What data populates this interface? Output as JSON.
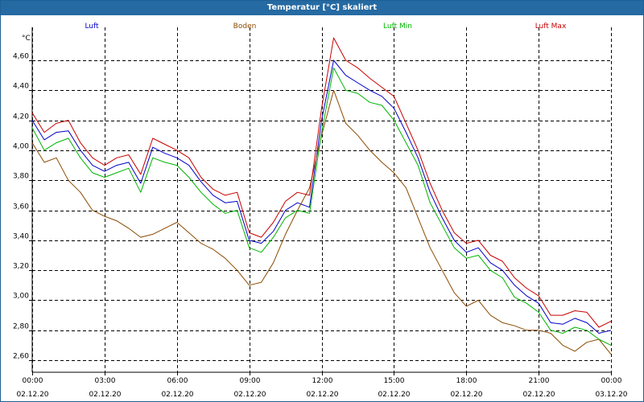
{
  "window": {
    "title": "Temperatur [°C] skaliert"
  },
  "colors": {
    "titlebar": "#256aa2",
    "grid": "#000000"
  },
  "chart_data": {
    "type": "line",
    "title": "Temperatur [°C] skaliert",
    "ylabel": "°C",
    "xlabel": "",
    "ylim": [
      2.52,
      4.82
    ],
    "grid": true,
    "legend": "top",
    "yticks": [
      2.6,
      2.8,
      3.0,
      3.2,
      3.4,
      3.6,
      3.8,
      4.0,
      4.2,
      4.4,
      4.6
    ],
    "ytick_labels": [
      "2,60",
      "2,80",
      "3,00",
      "3,20",
      "3,40",
      "3,60",
      "3,80",
      "4,00",
      "4,20",
      "4,40",
      "4,60"
    ],
    "x_hours_range": [
      0,
      24
    ],
    "xticks": [
      {
        "time": "00:00",
        "date": "02.12.20"
      },
      {
        "time": "03:00",
        "date": "02.12.20"
      },
      {
        "time": "06:00",
        "date": "02.12.20"
      },
      {
        "time": "09:00",
        "date": "02.12.20"
      },
      {
        "time": "12:00",
        "date": "02.12.20"
      },
      {
        "time": "15:00",
        "date": "02.12.20"
      },
      {
        "time": "18:00",
        "date": "02.12.20"
      },
      {
        "time": "21:00",
        "date": "02.12.20"
      },
      {
        "time": "00:00",
        "date": "03.12.20"
      }
    ],
    "x": [
      0,
      0.5,
      1,
      1.5,
      2,
      2.5,
      3,
      3.5,
      4,
      4.5,
      5,
      5.5,
      6,
      6.5,
      7,
      7.5,
      8,
      8.5,
      9,
      9.5,
      10,
      10.5,
      11,
      11.5,
      12,
      12.5,
      13,
      13.5,
      14,
      14.5,
      15,
      15.5,
      16,
      16.5,
      17,
      17.5,
      18,
      18.5,
      19,
      19.5,
      20,
      20.5,
      21,
      21.5,
      22,
      22.5,
      23,
      23.5,
      24
    ],
    "series": [
      {
        "name": "Luft",
        "color": "#0000c8",
        "values": [
          4.2,
          4.07,
          4.12,
          4.13,
          4.0,
          3.9,
          3.86,
          3.9,
          3.92,
          3.78,
          4.02,
          3.98,
          3.95,
          3.9,
          3.79,
          3.7,
          3.65,
          3.66,
          3.4,
          3.38,
          3.46,
          3.6,
          3.65,
          3.62,
          4.2,
          4.6,
          4.5,
          4.45,
          4.4,
          4.36,
          4.28,
          4.12,
          3.95,
          3.72,
          3.55,
          3.4,
          3.32,
          3.35,
          3.25,
          3.2,
          3.1,
          3.03,
          2.98,
          2.85,
          2.84,
          2.88,
          2.85,
          2.78,
          2.8
        ]
      },
      {
        "name": "Boden",
        "color": "#8b4a00",
        "values": [
          4.05,
          3.92,
          3.95,
          3.8,
          3.72,
          3.6,
          3.56,
          3.53,
          3.48,
          3.42,
          3.44,
          3.48,
          3.52,
          3.45,
          3.38,
          3.34,
          3.28,
          3.2,
          3.1,
          3.12,
          3.25,
          3.44,
          3.6,
          3.75,
          4.1,
          4.4,
          4.18,
          4.1,
          4.0,
          3.92,
          3.85,
          3.75,
          3.55,
          3.35,
          3.2,
          3.05,
          2.96,
          3.0,
          2.9,
          2.85,
          2.83,
          2.8,
          2.8,
          2.78,
          2.7,
          2.66,
          2.72,
          2.74,
          2.64
        ]
      },
      {
        "name": "Luft Min",
        "color": "#00b400",
        "values": [
          4.15,
          4.0,
          4.05,
          4.08,
          3.95,
          3.85,
          3.82,
          3.85,
          3.88,
          3.72,
          3.95,
          3.92,
          3.9,
          3.82,
          3.72,
          3.64,
          3.58,
          3.6,
          3.35,
          3.32,
          3.42,
          3.55,
          3.6,
          3.58,
          4.12,
          4.55,
          4.4,
          4.38,
          4.32,
          4.3,
          4.2,
          4.05,
          3.9,
          3.65,
          3.5,
          3.35,
          3.28,
          3.3,
          3.2,
          3.15,
          3.02,
          2.98,
          2.92,
          2.8,
          2.78,
          2.82,
          2.8,
          2.74,
          2.7
        ]
      },
      {
        "name": "Luft Max",
        "color": "#c80000",
        "values": [
          4.25,
          4.12,
          4.18,
          4.2,
          4.05,
          3.95,
          3.9,
          3.95,
          3.97,
          3.84,
          4.08,
          4.04,
          4.0,
          3.95,
          3.82,
          3.74,
          3.7,
          3.72,
          3.45,
          3.42,
          3.52,
          3.66,
          3.72,
          3.7,
          4.28,
          4.75,
          4.6,
          4.55,
          4.48,
          4.42,
          4.36,
          4.18,
          4.0,
          3.78,
          3.6,
          3.45,
          3.38,
          3.4,
          3.3,
          3.26,
          3.15,
          3.08,
          3.03,
          2.9,
          2.9,
          2.93,
          2.92,
          2.82,
          2.86
        ]
      }
    ]
  }
}
